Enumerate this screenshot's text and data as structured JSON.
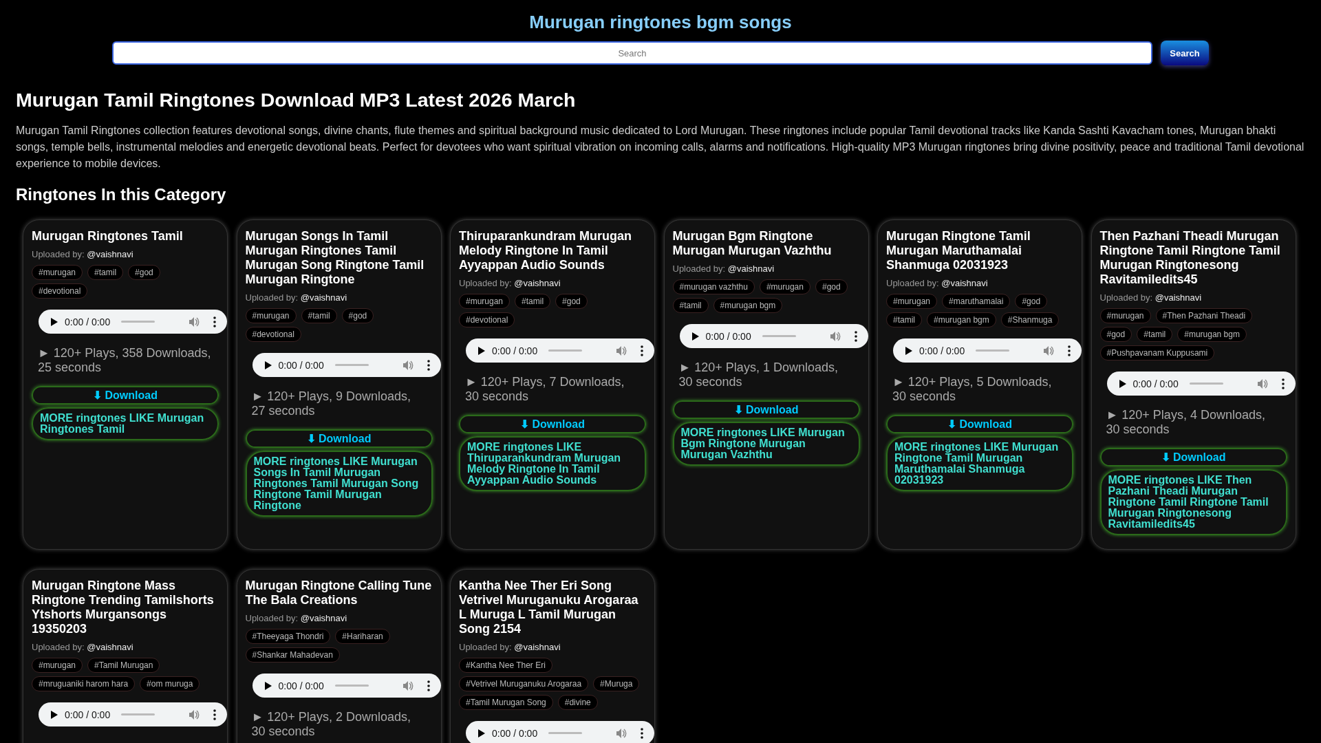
{
  "site_title": "Murugan ringtones bgm songs",
  "search": {
    "placeholder": "Search",
    "button": "Search"
  },
  "heading": "Murugan Tamil Ringtones Download MP3 Latest 2026 March",
  "intro": "Murugan Tamil Ringtones collection features devotional songs, divine chants, flute themes and spiritual background music dedicated to Lord Murugan. These ringtones include popular Tamil devotional tracks like Kanda Sashti Kavacham tones, Murugan bhakti songs, temple bells, instrumental melodies and energetic devotional beats. Perfect for devotees who want spiritual vibration on incoming calls, alarms and notifications. High-quality MP3 Murugan ringtones bring divine positivity, peace and traditional Tamil devotional experience to mobile devices.",
  "section_title": "Ringtones In this Category",
  "ringtones": [
    {
      "title": "Murugan Ringtones Tamil",
      "uploader_label": "Uploaded by:",
      "uploader": "@vaishnavi",
      "tags": [
        "#murugan",
        "#tamil",
        "#god",
        "#devotional"
      ],
      "player": {
        "time": "0:00 / 0:00",
        "level": 0
      },
      "stats": "► 120+ Plays, 358 Downloads, 25 seconds",
      "download": "⬇ Download",
      "more": "MORE ringtones LIKE Murugan Ringtones Tamil"
    },
    {
      "title": "Murugan Songs In Tamil Murugan Ringtones Tamil Murugan Song Ringtone Tamil Murugan Ringtone",
      "uploader_label": "Uploaded by:",
      "uploader": "@vaishnavi",
      "tags": [
        "#murugan",
        "#tamil",
        "#god",
        "#devotional"
      ],
      "player": {
        "time": "0:00 / 0:00",
        "level": 0
      },
      "stats": "► 120+ Plays, 9 Downloads, 27 seconds",
      "download": "⬇ Download",
      "more": "MORE ringtones LIKE Murugan Songs In Tamil Murugan Ringtones Tamil Murugan Song Ringtone Tamil Murugan Ringtone"
    },
    {
      "title": "Thiruparankundram Murugan Melody Ringtone In Tamil Ayyappan Audio Sounds",
      "uploader_label": "Uploaded by:",
      "uploader": "@vaishnavi",
      "tags": [
        "#murugan",
        "#tamil",
        "#god",
        "#devotional"
      ],
      "player": {
        "time": "0:00 / 0:00",
        "level": 0
      },
      "stats": "► 120+ Plays, 7 Downloads, 30 seconds",
      "download": "⬇ Download",
      "more": "MORE ringtones LIKE Thiruparankundram Murugan Melody Ringtone In Tamil Ayyappan Audio Sounds"
    },
    {
      "title": "Murugan Bgm Ringtone Murugan Murugan Vazhthu",
      "uploader_label": "Uploaded by:",
      "uploader": "@vaishnavi",
      "tags": [
        "#murugan vazhthu",
        "#murugan",
        "#god",
        "#tamil",
        "#murugan bgm"
      ],
      "player": {
        "time": "0:00 / 0:00",
        "level": 0
      },
      "stats": "► 120+ Plays, 1 Downloads, 30 seconds",
      "download": "⬇ Download",
      "more": "MORE ringtones LIKE Murugan Bgm Ringtone Murugan Murugan Vazhthu"
    },
    {
      "title": "Murugan Ringtone Tamil Murugan Maruthamalai Shanmuga 02031923",
      "uploader_label": "Uploaded by:",
      "uploader": "@vaishnavi",
      "tags": [
        "#murugan",
        "#maruthamalai",
        "#god",
        "#tamil",
        "#murugan bgm",
        "#Shanmuga"
      ],
      "player": {
        "time": "0:00 / 0:00",
        "level": 0
      },
      "stats": "► 120+ Plays, 5 Downloads, 30 seconds",
      "download": "⬇ Download",
      "more": "MORE ringtones LIKE Murugan Ringtone Tamil Murugan Maruthamalai Shanmuga 02031923"
    },
    {
      "title": "Then Pazhani Theadi Murugan Ringtone Tamil Ringtone Tamil Murugan Ringtonesong Ravitamiledits45",
      "uploader_label": "Uploaded by:",
      "uploader": "@vaishnavi",
      "tags": [
        "#murugan",
        "#Then Pazhani Theadi",
        "#god",
        "#tamil",
        "#murugan bgm",
        "#Pushpavanam Kuppusami"
      ],
      "player": {
        "time": "0:00 / 0:00",
        "level": 0
      },
      "stats": "► 120+ Plays, 4 Downloads, 30 seconds",
      "download": "⬇ Download",
      "more": "MORE ringtones LIKE Then Pazhani Theadi Murugan Ringtone Tamil Ringtone Tamil Murugan Ringtonesong Ravitamiledits45"
    },
    {
      "title": "Murugan Ringtone Mass Ringtone Trending Tamilshorts Ytshorts Murgansongs 19350203",
      "uploader_label": "Uploaded by:",
      "uploader": "@vaishnavi",
      "tags": [
        "#murugan",
        "#Tamil Murugan",
        "#mruguaniki harom hara",
        "#om muruga"
      ],
      "player": {
        "time": "0:00 / 0:00",
        "level": 0
      }
    },
    {
      "title": "Murugan Ringtone Calling Tune The Bala Creations",
      "uploader_label": "Uploaded by:",
      "uploader": "@vaishnavi",
      "tags": [
        "#Theeyaga Thondri",
        "#Hariharan",
        "#Shankar Mahadevan"
      ],
      "player": {
        "time": "0:00 / 0:00",
        "level": 0
      },
      "stats": "► 120+ Plays, 2 Downloads, 30 seconds"
    },
    {
      "title": "Kantha Nee Ther Eri Song Vetrivel Muruganuku Arogaraa L Muruga L Tamil Murugan Song 2154",
      "uploader_label": "Uploaded by:",
      "uploader": "@vaishnavi",
      "tags": [
        "#Kantha Nee Ther Eri",
        "#Vetrivel Muruganuku Arogaraa",
        "#Muruga",
        "#Tamil Murugan Song",
        "#divine"
      ],
      "player": {
        "time": "0:00 / 0:00",
        "level": 0
      }
    }
  ]
}
